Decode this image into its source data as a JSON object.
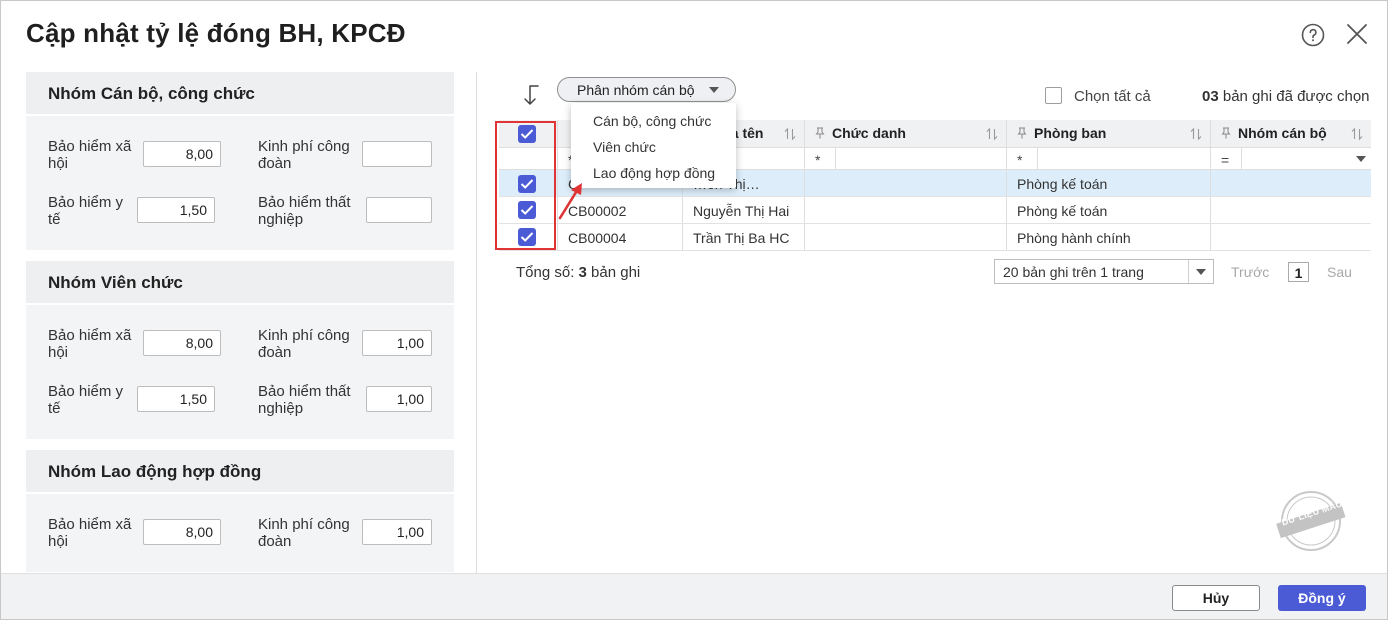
{
  "dialog": {
    "title": "Cập nhật tỷ lệ đóng BH, KPCĐ"
  },
  "groups": [
    {
      "name": "Nhóm Cán bộ, công chức",
      "bhxh_label": "Bảo hiểm xã hội",
      "bhxh_value": "8,00",
      "kpcd_label": "Kinh phí công đoàn",
      "kpcd_value": "",
      "bhyt_label": "Bảo hiểm y tế",
      "bhyt_value": "1,50",
      "bhtn_label": "Bảo hiểm thất nghiệp",
      "bhtn_value": ""
    },
    {
      "name": "Nhóm Viên chức",
      "bhxh_label": "Bảo hiểm xã hội",
      "bhxh_value": "8,00",
      "kpcd_label": "Kinh phí công đoàn",
      "kpcd_value": "1,00",
      "bhyt_label": "Bảo hiểm y tế",
      "bhyt_value": "1,50",
      "bhtn_label": "Bảo hiểm thất nghiệp",
      "bhtn_value": "1,00"
    },
    {
      "name": "Nhóm Lao động hợp đồng",
      "bhxh_label": "Bảo hiểm xã hội",
      "bhxh_value": "8,00",
      "kpcd_label": "Kinh phí công đoàn",
      "kpcd_value": "1,00"
    }
  ],
  "toolbar": {
    "group_button_label": "Phân nhóm cán bộ",
    "select_all_label": "Chọn tất cả",
    "selected_count": "03",
    "selected_suffix": " bản ghi đã được chọn"
  },
  "dropdown": {
    "items": [
      "Cán bộ, công chức",
      "Viên chức",
      "Lao động hợp đồng"
    ]
  },
  "table": {
    "columns": {
      "name": "và tên",
      "title": "Chức danh",
      "department": "Phòng ban",
      "group": "Nhóm cán bộ"
    },
    "filters": {
      "code_op": "*",
      "title_op": "*",
      "department_op": "*",
      "group_op": "="
    },
    "rows": [
      {
        "code": "C",
        "name": "…ễn Thị…",
        "title": "",
        "department": "Phòng kế toán",
        "group": ""
      },
      {
        "code": "CB00002",
        "name": "Nguyễn Thị Hai",
        "title": "",
        "department": "Phòng kế toán",
        "group": ""
      },
      {
        "code": "CB00004",
        "name": "Trần Thị Ba HC",
        "title": "",
        "department": "Phòng hành chính",
        "group": ""
      }
    ]
  },
  "pager": {
    "total_prefix": "Tổng số: ",
    "total_count": "3",
    "total_suffix": " bản ghi",
    "page_size": "20 bản ghi trên 1 trang",
    "prev": "Trước",
    "page": "1",
    "next": "Sau"
  },
  "stamp_text": "DỮ LIỆU MẪU",
  "footer": {
    "cancel_label": "Hủy",
    "ok_label": "Đồng ý"
  },
  "colors": {
    "accent": "#4b5bd6",
    "highlight": "#e03434",
    "selected_row": "#ddeefa"
  }
}
